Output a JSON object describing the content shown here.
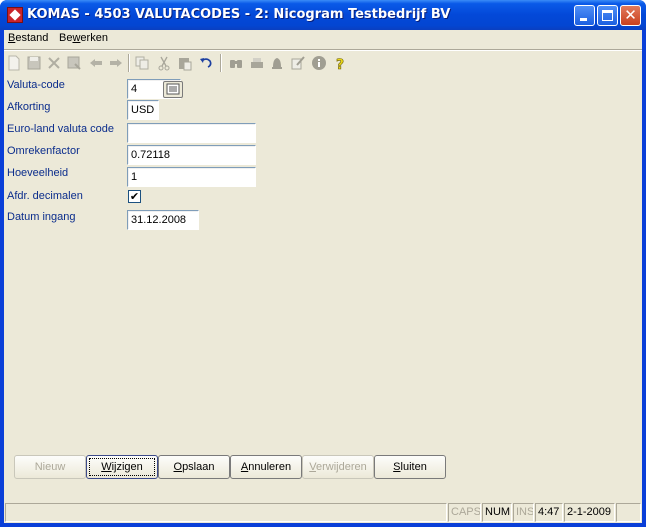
{
  "window": {
    "title": "KOMAS - 4503 VALUTACODES - 2: Nicogram Testbedrijf BV"
  },
  "menu": {
    "items": [
      {
        "label": "Bestand",
        "accel_index": 0
      },
      {
        "label": "Bewerken",
        "accel_index": 2
      }
    ]
  },
  "toolbar": {
    "icons": [
      "new-icon",
      "save-icon",
      "delete-icon",
      "save-as-icon",
      "back-arrow-icon",
      "forward-arrow-icon",
      "copy-icon",
      "cut-icon",
      "paste-icon",
      "undo-icon",
      "binoculars-icon",
      "print-icon",
      "bell-icon",
      "edit-icon",
      "info-icon",
      "help-icon"
    ]
  },
  "form": {
    "valuta_code": {
      "label": "Valuta-code",
      "value": "4"
    },
    "afkorting": {
      "label": "Afkorting",
      "value": "USD"
    },
    "euroland": {
      "label": "Euro-land valuta code",
      "value": ""
    },
    "omrekenfactor": {
      "label": "Omrekenfactor",
      "value": "0.72118"
    },
    "hoeveelheid": {
      "label": "Hoeveelheid",
      "value": "1"
    },
    "afdr_decimalen": {
      "label": "Afdr. decimalen",
      "checked": true,
      "mark": "✔"
    },
    "datum_ingang": {
      "label": "Datum ingang",
      "value": "31.12.2008"
    }
  },
  "buttons": {
    "nieuw": "Nieuw",
    "wijzigen": "Wijzigen",
    "opslaan": "Opslaan",
    "annuleren": "Annuleren",
    "verwijderen": "Verwijderen",
    "sluiten": "Sluiten"
  },
  "status": {
    "caps": "CAPS",
    "num": "NUM",
    "ins": "INS",
    "time": "4:47",
    "date": "2-1-2009"
  },
  "colors": {
    "label_text": "#0b2d8c",
    "titlebar": "#0348d8",
    "dialog_bg": "#ece9d8"
  }
}
